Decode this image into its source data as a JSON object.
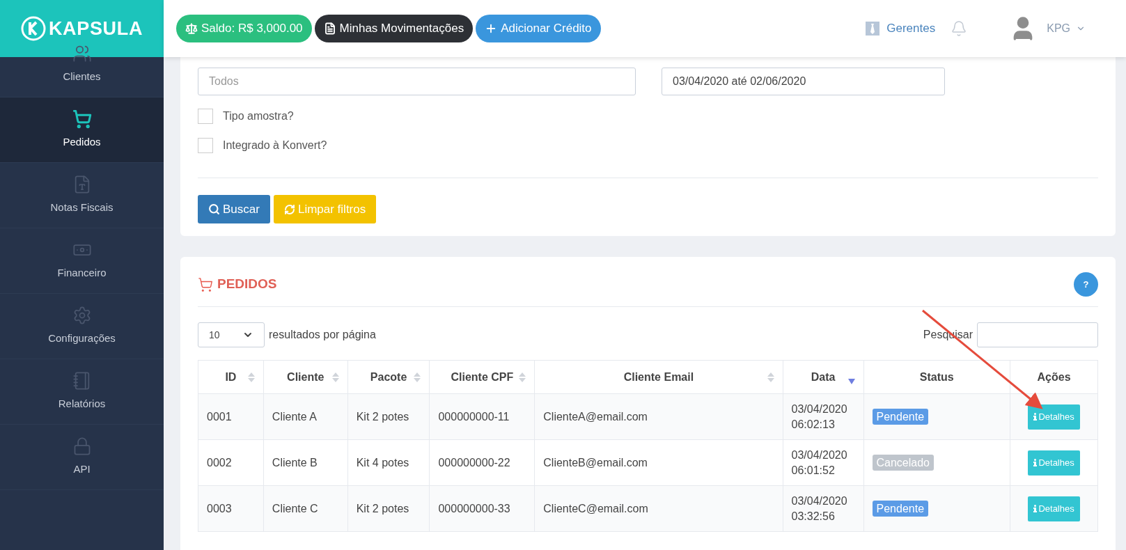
{
  "brand": {
    "name": "KAPSULA"
  },
  "header": {
    "buttons": [
      {
        "kind": "balance",
        "label": "Saldo: R$ 3,000.00"
      },
      {
        "kind": "statement",
        "label": "Minhas Movimentações"
      },
      {
        "kind": "credit",
        "label": "Adicionar Crédito"
      }
    ],
    "managers": "Gerentes",
    "user": "KPG"
  },
  "sidebar": {
    "items": [
      {
        "kind": "clients",
        "label": "Clientes",
        "selected": false
      },
      {
        "kind": "orders",
        "label": "Pedidos",
        "selected": true
      },
      {
        "kind": "invoices",
        "label": "Notas Fiscais",
        "selected": false
      },
      {
        "kind": "finance",
        "label": "Financeiro",
        "selected": false
      },
      {
        "kind": "settings",
        "label": "Configurações",
        "selected": false
      },
      {
        "kind": "reports",
        "label": "Relatórios",
        "selected": false
      },
      {
        "kind": "api",
        "label": "API",
        "selected": false
      }
    ]
  },
  "filters": {
    "status": {
      "placeholder": "Todos"
    },
    "date_range": {
      "value": "03/04/2020 até 02/06/2020"
    },
    "checkboxes": [
      {
        "label": "Tipo amostra?",
        "checked": false
      },
      {
        "label": "Integrado à Konvert?",
        "checked": false
      }
    ],
    "search_button": "Buscar",
    "clear_button": "Limpar filtros"
  },
  "orders": {
    "title": "PEDIDOS",
    "help": "?",
    "page_size": "10",
    "page_size_label": "resultados por página",
    "search_label": "Pesquisar",
    "columns": [
      {
        "label": "ID",
        "sortable": true,
        "sorted": false
      },
      {
        "label": "Cliente",
        "sortable": true,
        "sorted": false
      },
      {
        "label": "Pacote",
        "sortable": true,
        "sorted": false
      },
      {
        "label": "Cliente CPF",
        "sortable": true,
        "sorted": false
      },
      {
        "label": "Cliente Email",
        "sortable": true,
        "sorted": false
      },
      {
        "label": "Data",
        "sortable": true,
        "sorted": true
      },
      {
        "label": "Status",
        "sortable": false,
        "sorted": false
      },
      {
        "label": "Ações",
        "sortable": false,
        "sorted": false
      }
    ],
    "rows": [
      {
        "id": "0001",
        "client": "Cliente A",
        "package": "Kit 2 potes",
        "cpf": "000000000-11",
        "email": "ClienteA@email.com",
        "date": "03/04/2020",
        "time": "06:02:13",
        "status": {
          "label": "Pendente",
          "color": "#5b9be6"
        },
        "action": "Detalhes"
      },
      {
        "id": "0002",
        "client": "Cliente B",
        "package": "Kit 4 potes",
        "cpf": "000000000-22",
        "email": "ClienteB@email.com",
        "date": "03/04/2020",
        "time": "06:01:52",
        "status": {
          "label": "Cancelado",
          "color": "#bfc5cc"
        },
        "action": "Detalhes"
      },
      {
        "id": "0003",
        "client": "Cliente C",
        "package": "Kit 2 potes",
        "cpf": "000000000-33",
        "email": "ClienteC@email.com",
        "date": "03/04/2020",
        "time": "03:32:56",
        "status": {
          "label": "Pendente",
          "color": "#5b9be6"
        },
        "action": "Detalhes"
      }
    ]
  }
}
